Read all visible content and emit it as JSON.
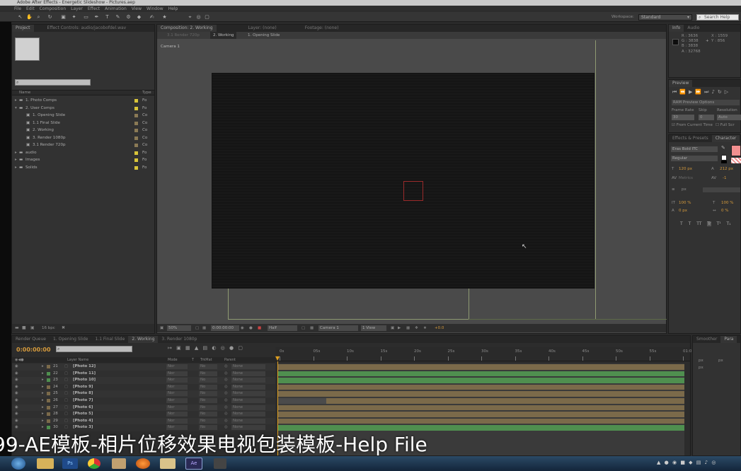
{
  "window": {
    "title": "Adobe After Effects - Energetic Slideshow - Pictures.aep"
  },
  "menu": [
    "File",
    "Edit",
    "Composition",
    "Layer",
    "Effect",
    "Animation",
    "View",
    "Window",
    "Help"
  ],
  "toolbar": {
    "workspace_label": "Workspace:",
    "workspace_value": "Standard",
    "search_placeholder": "Search Help"
  },
  "project": {
    "tabs": [
      "Project",
      "Effect Controls: audio/jacobofdel.wav"
    ],
    "search_placeholder": "",
    "col_name": "Name",
    "col_type": "Type",
    "items": [
      {
        "label": "1. Photo Comps",
        "type": "Fo",
        "color": "#d8c43a",
        "indent": 0,
        "kind": "folder"
      },
      {
        "label": "2. User Comps",
        "type": "Fo",
        "color": "#d8c43a",
        "indent": 0,
        "kind": "folder"
      },
      {
        "label": "1. Opening Slide",
        "type": "Co",
        "color": "#8a7a55",
        "indent": 1,
        "kind": "comp"
      },
      {
        "label": "1.1 Final Slide",
        "type": "Co",
        "color": "#8a7a55",
        "indent": 1,
        "kind": "comp"
      },
      {
        "label": "2. Working",
        "type": "Co",
        "color": "#8a7a55",
        "indent": 1,
        "kind": "comp"
      },
      {
        "label": "3. Render 1080p",
        "type": "Co",
        "color": "#8a7a55",
        "indent": 1,
        "kind": "comp"
      },
      {
        "label": "3.1 Render 720p",
        "type": "Co",
        "color": "#8a7a55",
        "indent": 1,
        "kind": "comp"
      },
      {
        "label": "audio",
        "type": "Fo",
        "color": "#d8c43a",
        "indent": 0,
        "kind": "folder"
      },
      {
        "label": "Images",
        "type": "Fo",
        "color": "#d8c43a",
        "indent": 0,
        "kind": "folder"
      },
      {
        "label": "Solids",
        "type": "Fo",
        "color": "#d8c43a",
        "indent": 0,
        "kind": "folder"
      }
    ],
    "bpc": "16 bpc"
  },
  "composition": {
    "tabs": [
      "Composition: 2. Working",
      "Layer: (none)",
      "Footage: (none)"
    ],
    "breadcrumbs": [
      "3.1 Render 720p",
      "2. Working",
      "1. Opening Slide"
    ],
    "camera_label": "Camera 1",
    "zoom": "50%",
    "timecode": "0:00:00:00",
    "resolution": "Half",
    "view_camera": "Camera 1",
    "views": "1 View",
    "exposure": "+0.0"
  },
  "info": {
    "tabs": [
      "Info",
      "Audio"
    ],
    "r": "R : 3636",
    "g": "G : 3838",
    "b": "B : 3838",
    "a": "A : 32768",
    "x": "X : 1559",
    "y": "Y : 856"
  },
  "preview": {
    "tab": "Preview",
    "ram_options": "RAM Preview Options",
    "frame_rate_label": "Frame Rate",
    "skip_label": "Skip",
    "resolution_label": "Resolution",
    "frame_rate": "30",
    "skip": "0",
    "resolution": "Auto",
    "from_current": "From Current Time",
    "full_screen": "Full Scr"
  },
  "character": {
    "tabs": [
      "Effects & Presets",
      "Character"
    ],
    "font": "Eras Bold ITC",
    "style": "Regular",
    "size": "120 px",
    "leading": "212 px",
    "tracking": "Metrics",
    "kerning": "-1",
    "stroke": "px",
    "vscale": "100 %",
    "hscale": "100 %",
    "baseline": "0 px",
    "tsume": "0 %",
    "fill_color": "#f28f8f"
  },
  "timeline": {
    "tabs": [
      "Render Queue",
      "1. Opening Slide",
      "1.1 Final Slide",
      "2. Working",
      "3. Render 1080p"
    ],
    "timecode": "0:00:00:00",
    "headers": {
      "layer": "Layer Name",
      "mode": "Mode",
      "t": "T",
      "trkmat": "TrkMat",
      "parent": "Parent"
    },
    "ruler": [
      "0s",
      "05s",
      "10s",
      "15s",
      "20s",
      "25s",
      "30s",
      "35s",
      "40s",
      "45s",
      "50s",
      "55s",
      "01:0"
    ],
    "layers": [
      {
        "num": "21",
        "name": "[Photo 12]",
        "color": "#7b6a4a",
        "mode": "Nor",
        "trk": "No",
        "parent": "None"
      },
      {
        "num": "22",
        "name": "[Photo 11]",
        "color": "#4f8f4f",
        "mode": "Nor",
        "trk": "No",
        "parent": "None"
      },
      {
        "num": "23",
        "name": "[Photo 10]",
        "color": "#4f8f4f",
        "mode": "Nor",
        "trk": "No",
        "parent": "None"
      },
      {
        "num": "24",
        "name": "[Photo 9]",
        "color": "#7b6a4a",
        "mode": "Nor",
        "trk": "No",
        "parent": "None"
      },
      {
        "num": "25",
        "name": "[Photo 8]",
        "color": "#7b6a4a",
        "mode": "Nor",
        "trk": "No",
        "parent": "None"
      },
      {
        "num": "26",
        "name": "[Photo 7]",
        "color": "#7b6a4a",
        "mode": "Nor",
        "trk": "No",
        "parent": "None"
      },
      {
        "num": "27",
        "name": "[Photo 6]",
        "color": "#7b6a4a",
        "mode": "Nor",
        "trk": "No",
        "parent": "None"
      },
      {
        "num": "28",
        "name": "[Photo 5]",
        "color": "#7b6a4a",
        "mode": "Nor",
        "trk": "No",
        "parent": "None"
      },
      {
        "num": "29",
        "name": "[Photo 4]",
        "color": "#7b6a4a",
        "mode": "Nor",
        "trk": "No",
        "parent": "None"
      },
      {
        "num": "30",
        "name": "[Photo 3]",
        "color": "#4f8f4f",
        "mode": "Nor",
        "trk": "No",
        "parent": "None"
      }
    ]
  },
  "paragraph": {
    "tabs": [
      "Smoother",
      "Para"
    ],
    "indent1": "px",
    "indent2": "px",
    "indent3": "px"
  },
  "overlay_title": "99-AE模板-相片位移效果电视包装模板-Help File"
}
